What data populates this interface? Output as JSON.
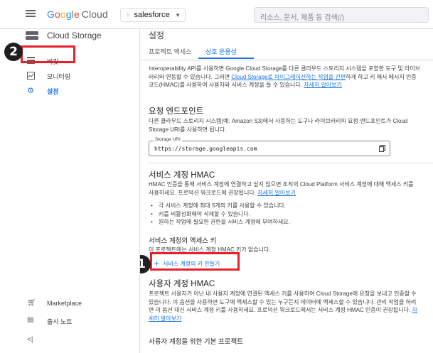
{
  "header": {
    "logo_google": "Google",
    "logo_cloud": "Cloud",
    "project": "salesforce",
    "search_placeholder": "리소스, 문서, 제품 등 검색(/)"
  },
  "sidebar": {
    "title": "Cloud Storage",
    "items": [
      {
        "label": "버킷",
        "icon": "buckets-icon",
        "active": false
      },
      {
        "label": "모니터링",
        "icon": "monitoring-icon",
        "active": false
      },
      {
        "label": "설정",
        "icon": "gear-icon",
        "active": true
      }
    ],
    "bottom_items": [
      {
        "label": "Marketplace",
        "icon": "marketplace-icon"
      },
      {
        "label": "출시 노트",
        "icon": "release-notes-icon"
      }
    ],
    "collapse_icon": "collapse-icon"
  },
  "annotations": {
    "badge_1": "1",
    "badge_2": "2",
    "highlight_color": "#e8202a"
  },
  "main": {
    "page_title": "설정",
    "tabs": [
      {
        "label": "프로젝트 액세스",
        "selected": false
      },
      {
        "label": "상호 운용성",
        "selected": true
      }
    ],
    "intro": {
      "text_a": "Interoperability API를 사용하면 Google Cloud Storage를 다른 클라우드 스토리지 시스템을 포함한 도구 및 라이브러리와 연동할 수 있습니다. 그러면 ",
      "link_a": "Cloud Storage로 마이그레이션하는 작업을 간편",
      "text_b": "하게 하고 키 해시 메시지 인증 코드(HMAC)를 사용하여 사용자와 서비스 계정을 들 수 있습니다. ",
      "link_b": "자세히 알아보기"
    },
    "endpoint": {
      "heading": "요청 엔드포인트",
      "desc": "다른 클라우드 스토리지 시스템(예: Amazon S3)에서 사용하는 도구나 라이브러리의 요청 엔드포인트가 Cloud Storage URI를 사용하면 됩니다.",
      "uri_label": "Storage URI",
      "uri_value": "https://storage.googleapis.com",
      "copy_icon": "copy-icon"
    },
    "service_hmac": {
      "heading": "서비스 계정 HMAC",
      "desc": "HMAC 인증을 통해 서비스 계정에 연결하고 싶지 않으면 조직의 Cloud Platform 서비스 계정에 대해 액세스 키를 사용하세요. 프로덕션 워크로드에 권장됩니다. ",
      "link": "자세히 알아보기",
      "bullets": [
        "각 서비스 계정에 최대 5개의 키를 사용할 수 있습니다.",
        "키를 비활성화해야 삭제할 수 있습니다.",
        "원하는 작업에 필요한 권한을 서비스 계정에 부여하세요."
      ],
      "keys_heading": "서비스 계정의 액세스 키",
      "keys_empty": "이 프로젝트에는 서비스 계정 HMAC 키가 없습니다.",
      "create_button": "서비스 계정의 키 만들기"
    },
    "user_hmac": {
      "heading": "사용자 계정 HMAC",
      "desc": "프로젝트 사용자가 아닌 내 사용자 계정에 연결된 액세스 키를 사용하여 Cloud Storage에 요청을 보내고 인증할 수 있습니다. 이 옵션을 사용하면 도구에 액세스할 수 있는 누구든지 데이터에 액세스할 수 있습니다. 관리 작업을 하려면 이 옵션 대신 서비스 계정 키를 사용하세요. 프로덕션 워크로드에서는 서비스 계정 HMAC 인증이 권장됩니다. ",
      "link": "자세히 알아보기",
      "subheading": "사용자 계정을 위한 기본 프로젝트"
    }
  }
}
